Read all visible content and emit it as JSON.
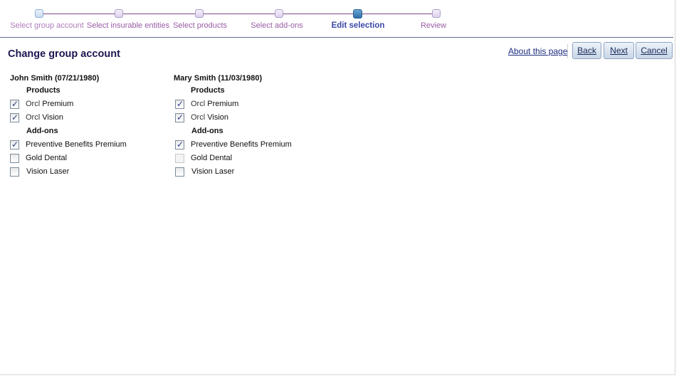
{
  "train": {
    "steps": [
      {
        "label": "Select group account"
      },
      {
        "label": "Select insurable entities"
      },
      {
        "label": "Select products"
      },
      {
        "label": "Select add-ons"
      },
      {
        "label": "Edit selection",
        "current": true
      },
      {
        "label": "Review"
      }
    ]
  },
  "header": {
    "title": "Change group account",
    "about_link": "About this page",
    "back_label": "Back",
    "next_label": "Next",
    "cancel_label": "Cancel"
  },
  "members": [
    {
      "name": "John Smith (07/21/1980)",
      "products_heading": "Products",
      "products": [
        {
          "prefix": "Orcl",
          "label": "Premium",
          "checked": true
        },
        {
          "prefix": "Orcl",
          "label": "Vision",
          "checked": true
        }
      ],
      "addons_heading": "Add-ons",
      "addons": [
        {
          "label": "Preventive Benefits Premium",
          "checked": true
        },
        {
          "label": "Gold Dental",
          "checked": false
        },
        {
          "label": "Vision Laser",
          "checked": false
        }
      ]
    },
    {
      "name": "Mary Smith (11/03/1980)",
      "products_heading": "Products",
      "products": [
        {
          "prefix": "Orcl",
          "label": "Premium",
          "checked": true
        },
        {
          "prefix": "Orcl",
          "label": "Vision",
          "checked": true
        }
      ],
      "addons_heading": "Add-ons",
      "addons": [
        {
          "label": "Preventive Benefits Premium",
          "checked": true
        },
        {
          "label": "Gold Dental",
          "checked": false,
          "disabled": true
        },
        {
          "label": "Vision Laser",
          "checked": false
        }
      ]
    }
  ],
  "colors": {
    "train_line": "#7a4a8a",
    "current_step": "#3b48a6",
    "link": "#1d2d80",
    "title": "#1c1650"
  }
}
